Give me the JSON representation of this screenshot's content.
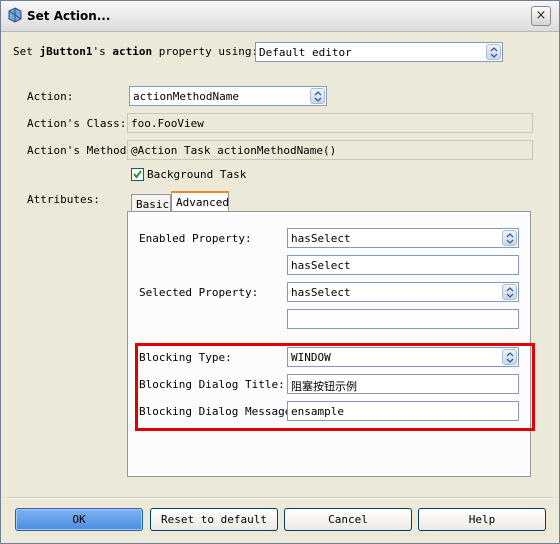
{
  "window": {
    "title": "Set Action..."
  },
  "top": {
    "label_prefix": "Set ",
    "label_bold_1": "jButton1",
    "label_mid": "'s ",
    "label_bold_2": "action",
    "label_suffix": " property using:",
    "editor_value": "Default editor"
  },
  "form": {
    "action_label": "Action:",
    "action_value": "actionMethodName",
    "class_label": "Action's Class:",
    "class_value": "foo.FooView",
    "method_label": "Action's Method:",
    "method_value": "@Action Task actionMethodName()",
    "background_task_label": "Background Task",
    "background_task_checked": true,
    "attributes_label": "Attributes:"
  },
  "tabs": [
    {
      "label": "Basic"
    },
    {
      "label": "Advanced"
    }
  ],
  "advanced": {
    "enabled_label": "Enabled Property:",
    "enabled_combo": "hasSelect",
    "enabled_field": "hasSelect",
    "selected_label": "Selected Property:",
    "selected_combo": "hasSelect",
    "selected_field": "",
    "blocking_type_label": "Blocking Type:",
    "blocking_type_value": "WINDOW",
    "dialog_title_label": "Blocking Dialog Title:",
    "dialog_title_value": "阻塞按钮示例",
    "dialog_message_label": "Blocking Dialog Message:",
    "dialog_message_value": "ensample"
  },
  "buttons": {
    "ok": "OK",
    "reset": "Reset to default",
    "cancel": "Cancel",
    "help": "Help"
  },
  "colors": {
    "highlight_box": "#e00000",
    "active_tab_accent": "#e68b2c",
    "ok_button": "#4a8be0"
  }
}
